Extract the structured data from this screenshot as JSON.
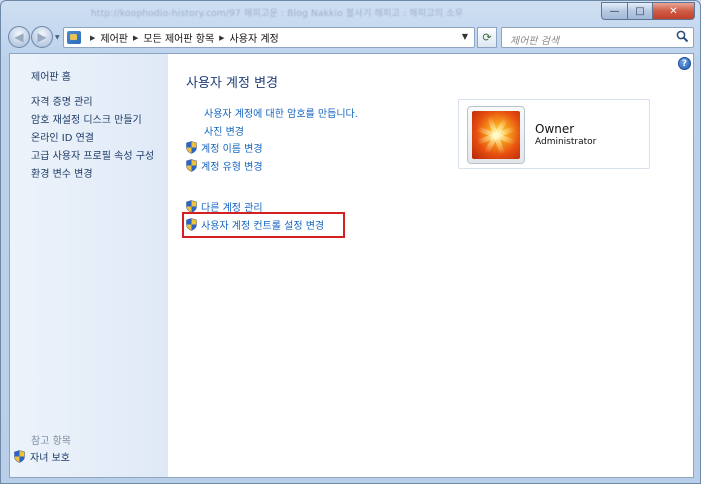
{
  "window": {
    "title_blurred": "http://koophodio-history.com/97   해피고운 : Blog Nakkio 불사기 해피고 : 해피고의 소우",
    "min_glyph": "—",
    "max_glyph": "□",
    "close_glyph": "✕"
  },
  "nav": {
    "back_glyph": "◀",
    "forward_glyph": "▶",
    "breadcrumb": [
      "제어판",
      "모든 제어판 항목",
      "사용자 계정"
    ],
    "refresh_glyph": "⟳",
    "search_placeholder": "제어판 검색"
  },
  "sidebar": {
    "home": "제어판 홈",
    "tasks": [
      "자격 증명 관리",
      "암호 재설정 디스크 만들기",
      "온라인 ID 연결",
      "고급 사용자 프로필 속성 구성",
      "환경 변수 변경"
    ],
    "see_also": "참고 항목",
    "parental": "자녀 보호"
  },
  "main": {
    "title": "사용자 계정 변경",
    "links": {
      "create_password": "사용자 계정에 대한 암호를 만듭니다.",
      "change_picture": "사진 변경",
      "change_name": "계정 이름 변경",
      "change_type": "계정 유형 변경",
      "manage_other": "다른 계정 관리",
      "uac_settings": "사용자 계정 컨트롤 설정 변경"
    },
    "help": "?"
  },
  "account": {
    "name": "Owner",
    "role": "Administrator"
  },
  "colors": {
    "link": "#1565c0",
    "highlight": "#d42020",
    "title": "#1e3d78"
  }
}
